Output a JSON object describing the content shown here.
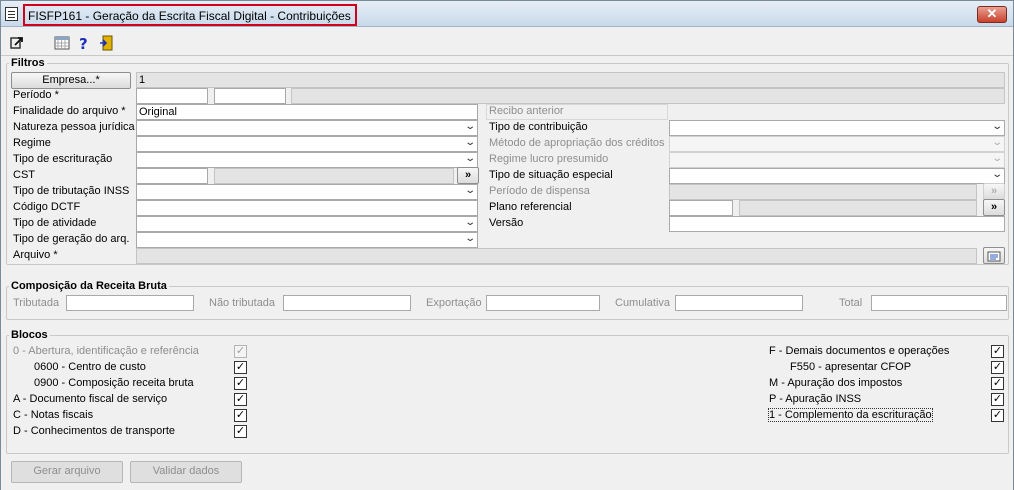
{
  "window": {
    "title": "FISFP161 - Geração da Escrita Fiscal Digital - Contribuições",
    "close_label": "✕"
  },
  "toolbar": {
    "icons": [
      "export-icon",
      "calendar-icon",
      "help-icon",
      "exit-door-icon"
    ],
    "help_glyph": "?"
  },
  "filtros": {
    "legend": "Filtros",
    "empresa_button": "Empresa...*",
    "empresa_value": "1",
    "periodo_label": "Período *",
    "finalidade_label": "Finalidade do arquivo *",
    "finalidade_value": "Original",
    "natureza_label": "Natureza pessoa jurídica",
    "regime_label": "Regime",
    "tipo_escrituracao_label": "Tipo de escrituração",
    "cst_label": "CST",
    "tipo_tributacao_label": "Tipo de tributação INSS",
    "codigo_dctf_label": "Código DCTF",
    "tipo_atividade_label": "Tipo de atividade",
    "tipo_geracao_label": "Tipo de geração do arq.",
    "arquivo_label": "Arquivo *",
    "recibo_label": "Recibo anterior",
    "tipo_contribuicao_label": "Tipo de contribuição",
    "metodo_label": "Método de apropriação dos créditos",
    "regime_lucro_label": "Regime lucro presumido",
    "tipo_situacao_label": "Tipo de situação especial",
    "periodo_dispensa_label": "Período de dispensa",
    "plano_referencial_label": "Plano referencial",
    "versao_label": "Versão",
    "lookup_label": "»"
  },
  "receita": {
    "legend": "Composição da Receita Bruta",
    "tributada_label": "Tributada",
    "nao_tributada_label": "Não tributada",
    "exportacao_label": "Exportação",
    "cumulativa_label": "Cumulativa",
    "total_label": "Total"
  },
  "blocos": {
    "legend": "Blocos",
    "left": [
      {
        "label": "0 - Abertura, identificação e referência",
        "checked": true,
        "disabled": true
      },
      {
        "label": "0600 - Centro de custo",
        "checked": true,
        "disabled": false
      },
      {
        "label": "0900 - Composição receita bruta",
        "checked": true,
        "disabled": false
      },
      {
        "label": "A - Documento fiscal de serviço",
        "checked": true,
        "disabled": false
      },
      {
        "label": "C - Notas fiscais",
        "checked": true,
        "disabled": false
      },
      {
        "label": "D - Conhecimentos de transporte",
        "checked": true,
        "disabled": false
      }
    ],
    "right": [
      {
        "label": "F - Demais documentos e operações",
        "checked": true
      },
      {
        "label": "F550 - apresentar CFOP",
        "checked": true
      },
      {
        "label": "M - Apuração dos impostos",
        "checked": true
      },
      {
        "label": "P - Apuração INSS",
        "checked": true
      },
      {
        "label": "1 - Complemento da escrituração",
        "checked": true
      }
    ],
    "check_glyph": "✓"
  },
  "actions": {
    "gerar": "Gerar arquivo",
    "validar": "Validar dados"
  }
}
